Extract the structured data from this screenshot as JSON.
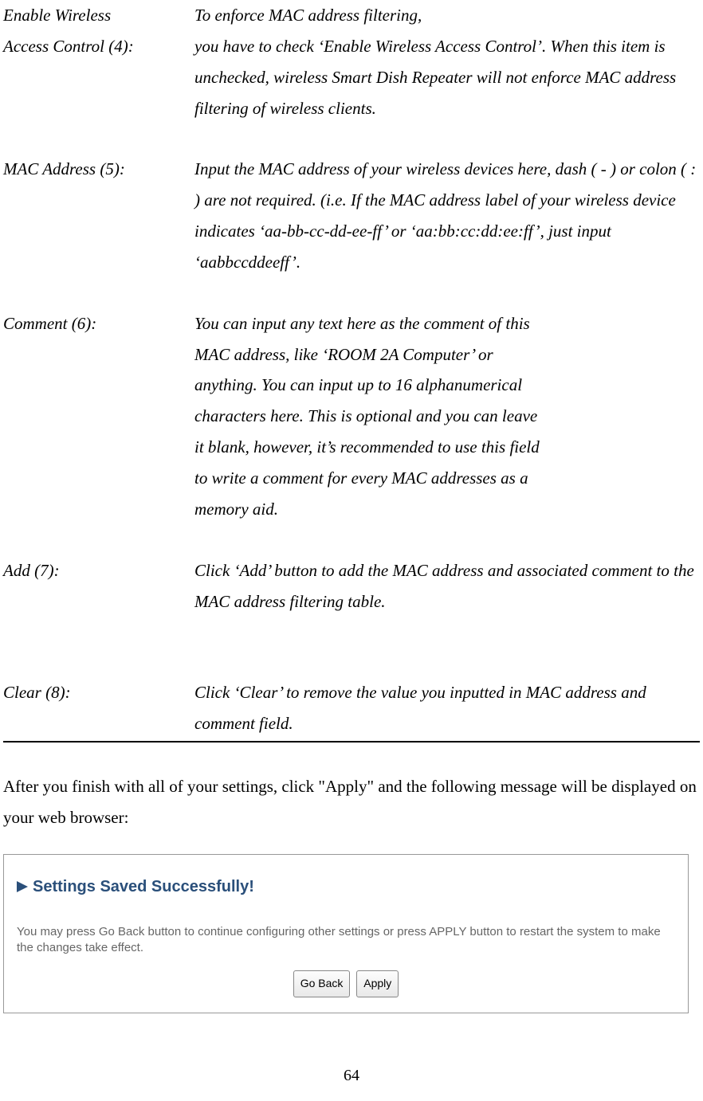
{
  "definitions": [
    {
      "label_line1": "Enable Wireless",
      "label_line2": "Access Control (4):",
      "text": "To enforce MAC address filtering,\nyou have to check 'Enable Wireless Access Control'. When this item is unchecked, wireless Smart Dish Repeater will not enforce MAC address filtering of wireless clients."
    },
    {
      "label_line1": "MAC Address (5):",
      "label_line2": "",
      "text": "Input the MAC address of your wireless devices here, dash ( - ) or colon ( : ) are not required. (i.e. If the MAC address label of your wireless device indicates 'aa-bb-cc-dd-ee-ff' or 'aa:bb:cc:dd:ee:ff', just input 'aabbccddeeff'."
    },
    {
      "label_line1": "Comment (6):",
      "label_line2": "",
      "text": "You can input any text here as the comment of this MAC address, like 'ROOM 2A Computer' or anything. You can input up to 16 alphanumerical characters here. This is optional and you can leave it blank, however, it's recommended to use this field to write a comment for every MAC addresses as a memory aid."
    },
    {
      "label_line1": "Add (7):",
      "label_line2": "",
      "text": "Click 'Add' button to add the MAC address and associated comment to the MAC address filtering table."
    },
    {
      "label_line1": "Clear (8):",
      "label_line2": "",
      "text": "Click 'Clear' to remove the value you inputted in MAC address and comment field."
    }
  ],
  "after_text": "After you finish with all of your settings, click \"Apply\" and the following message will be displayed on your web browser:",
  "dialog": {
    "title": "Settings Saved Successfully!",
    "body": "You may press Go Back button to continue configuring other settings or press APPLY button to restart the system to make the changes take effect.",
    "go_back": "Go Back",
    "apply": "Apply"
  },
  "page_number": "64"
}
